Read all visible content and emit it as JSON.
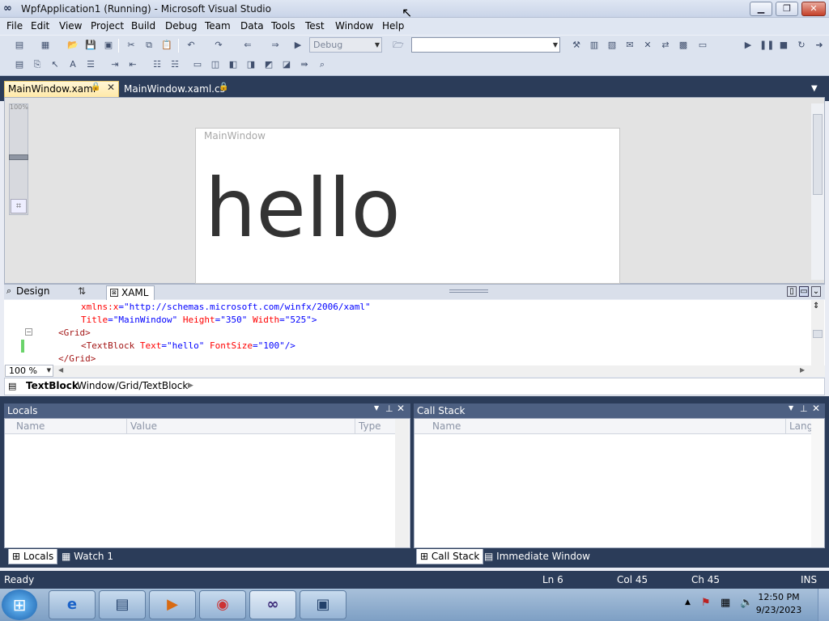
{
  "window": {
    "title": "WpfApplication1 (Running) - Microsoft Visual Studio",
    "icon": "vs-infinity-icon",
    "controls": {
      "minimize": "▁",
      "restore": "❐",
      "close": "✕"
    }
  },
  "menu": [
    "File",
    "Edit",
    "View",
    "Project",
    "Build",
    "Debug",
    "Team",
    "Data",
    "Tools",
    "Test",
    "Window",
    "Help"
  ],
  "toolbar": {
    "configuration": "Debug",
    "platform": ""
  },
  "tabs": {
    "main": "MainWindow.xaml",
    "code": "MainWindow.xaml.cs"
  },
  "designer": {
    "zoom_scale_label": "100%",
    "zoom_level": 0.5,
    "preview_title": "MainWindow",
    "preview_text": "hello"
  },
  "view_tabs": {
    "design": "Design",
    "swap": "⇅",
    "xaml": "XAML"
  },
  "code": {
    "lines": [
      {
        "a": "xmlns:x",
        "v": "=\"http://schemas.microsoft.com/winfx/2006/xaml\""
      },
      {
        "a": "Title",
        "v": "=\"MainWindow\" ",
        "a2": "Height",
        "v2": "=\"350\" ",
        "a3": "Width",
        "v3": "=\"525\">"
      },
      {
        "e": "<Grid>"
      },
      {
        "e": "<TextBlock ",
        "a": "Text",
        "v": "=\"hello\" ",
        "a2": "FontSize",
        "v2": "=\"100\"/>"
      },
      {
        "e": "</Grid>"
      }
    ],
    "zoom": "100 %"
  },
  "breadcrumb": {
    "element": "TextBlock",
    "path": "Window/Grid/TextBlock"
  },
  "locals": {
    "title": "Locals",
    "columns": [
      "Name",
      "Value",
      "Type"
    ],
    "tabs": [
      "Locals",
      "Watch 1"
    ]
  },
  "callstack": {
    "title": "Call Stack",
    "columns": [
      "Name",
      "Lang"
    ],
    "tabs": [
      "Call Stack",
      "Immediate Window"
    ]
  },
  "status": {
    "state": "Ready",
    "ln": "Ln 6",
    "col": "Col 45",
    "ch": "Ch 45",
    "mode": "INS"
  },
  "taskbar": {
    "time": "12:50 PM",
    "date": "9/23/2023"
  }
}
